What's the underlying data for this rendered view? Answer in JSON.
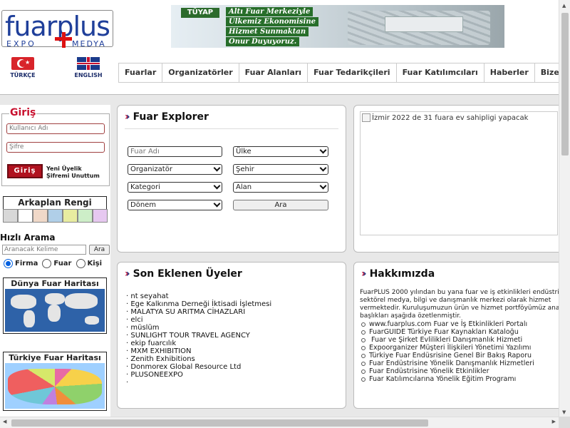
{
  "logo": {
    "word": "fuarplus",
    "expo": "EXPO",
    "medya": "MEDYA"
  },
  "banner": {
    "brand": "TÜYAP",
    "lines": [
      "Altı Fuar Merkeziyle",
      "Ülkemiz Ekonomisine",
      "Hizmet Sunmaktan",
      "Onur Duyuyoruz."
    ]
  },
  "languages": {
    "tr": "TÜRKÇE",
    "en": "ENGLISH"
  },
  "nav": [
    "Fuarlar",
    "Organizatörler",
    "Fuar Alanları",
    "Fuar Tedarikçileri",
    "Fuar Katılımcıları",
    "Haberler",
    "Bize Ulaşın"
  ],
  "login": {
    "title": "Giriş",
    "username_placeholder": "Kullanıcı Adı",
    "password_placeholder": "Şifre",
    "button": "Giriş",
    "register": "Yeni Üyelik",
    "forgot": "Şifremi Unuttum"
  },
  "background_color": {
    "title": "Arkaplan Rengi",
    "swatches": [
      "#d8d8d8",
      "#ffffff",
      "#f0d8c8",
      "#b0cfe8",
      "#e8eca0",
      "#cdeec8",
      "#e6c8f0"
    ]
  },
  "quick_search": {
    "title": "Hızlı Arama",
    "placeholder": "Aranacak Kelime",
    "button": "Ara",
    "options": [
      "Firma",
      "Fuar",
      "Kişi"
    ],
    "selected": "Firma"
  },
  "maps": {
    "world": "Dünya Fuar Haritası",
    "turkey": "Türkiye Fuar Haritası"
  },
  "explorer": {
    "title": "Fuar Explorer",
    "fuar_adi_placeholder": "Fuar Adı",
    "ulke": "Ülke",
    "organizator": "Organizatör",
    "sehir": "Şehir",
    "kategori": "Kategori",
    "alan": "Alan",
    "donem": "Dönem",
    "button": "Ara"
  },
  "news": {
    "image_alt": "İzmir 2022 de 31 fuara ev sahipligi yapacak"
  },
  "new_members": {
    "title": "Son Eklenen Üyeler",
    "items": [
      "nt seyahat",
      "Ege Kalkınma Derneği İktisadi İşletmesi",
      "MALATYA SU ARITMA CİHAZLARI",
      "elci",
      "müslüm",
      "SUNLIGHT TOUR TRAVEL AGENCY",
      "ekip fuarcılık",
      "MXM EXHIBITION",
      "Zenith Exhibitions",
      "Donmorex Global Resource Ltd",
      "PLUSONEEXPO"
    ]
  },
  "about": {
    "title": "Hakkımızda",
    "text_lines": [
      "FuarPLUS 2000 yılından bu yana fuar ve iş etkinlikleri endüstri",
      "sektörel medya, bilgi ve danışmanlık merkezi olarak hizmet",
      "vermektedir. Kuruluşumuzun ürün ve hizmet portföyümüz ana",
      "başlıkları aşağıda özetlenmiştir."
    ],
    "items": [
      "www.fuarplus.com Fuar ve İş Etkinlikleri Portalı",
      "FuarGUIDE Türkiye Fuar Kaynakları Kataloğu",
      " Fuar ve Şirket Evlilikleri Danışmanlık Hizmeti",
      "Expoorganizer Müşteri İlişkileri Yönetimi Yazılımı",
      "Türkiye Fuar Endüsrisine Genel Bir Bakış Raporu",
      "Fuar Endüstrisine Yönelik Danışmanlık Hizmetleri",
      "Fuar Endüstrisine Yönelik Etkinlikler",
      "Fuar Katılımcılarına Yönelik Eğitim Programı"
    ]
  }
}
